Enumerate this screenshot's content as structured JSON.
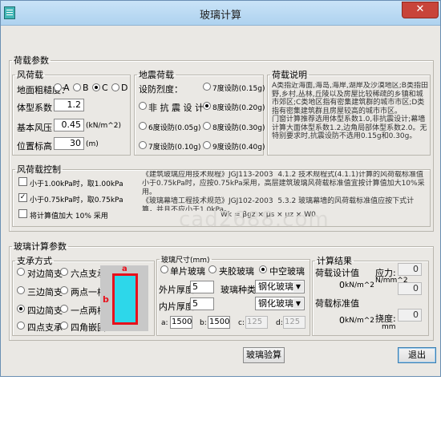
{
  "window": {
    "title": "玻璃计算",
    "close_glyph": "✕"
  },
  "load_group": {
    "legend": "荷载参数",
    "wind": {
      "legend": "风荷载",
      "roughness_label": "地面粗糙度：",
      "roughness_options": [
        "A",
        "B",
        "C",
        "D"
      ],
      "roughness_selected": "C",
      "shape_label": "体型系数：",
      "shape_value": "1.2",
      "base_pressure_label": "基本风压：",
      "base_pressure_value": "0.45",
      "base_pressure_unit": "(kN/m^2)",
      "height_label": "位置标高：",
      "height_value": "30",
      "height_unit": "(m)"
    },
    "seismic": {
      "legend": "地震荷载",
      "intensity_label": "设防烈度：",
      "options": [
        "非 抗 震 设 计",
        "6度设防(0.05g)",
        "7度设防(0.10g)",
        "7度设防(0.15g)",
        "8度设防(0.20g)",
        "8度设防(0.30g)",
        "9度设防(0.40g)"
      ],
      "selected": "8度设防(0.20g)"
    },
    "note": {
      "legend": "荷载说明",
      "text": "A类指近海面,海岛,海岸,湖岸及沙漠地区;B类指田野,乡村,丛林,丘陵以及房屋比较稀疏的乡镇和城市郊区;C类地区指有密集建筑群的城市市区;D类指有密集建筑群且房屋较高的城市市区。\n门窗计算推荐选用体型系数1.0,非抗震设计;幕墙计算大面体型系数1.2,边角局部体型系数2.0。无特别要求时,抗震设防不选用0.15g和0.30g。"
    },
    "wind_control": {
      "legend": "风荷载控制",
      "options": [
        {
          "label": "小于1.00kPa时，取1.00kPa",
          "checked": false
        },
        {
          "label": "小于0.75kPa时，取0.75kPa",
          "checked": true
        },
        {
          "label": "将计算值加大 10% 采用",
          "checked": false
        }
      ],
      "spec_text": "《建筑玻璃应用技术规程》JGJ113-2003  4.1.2 技术规程式(4.1.1)计算的风荷载标准值小于0.75kPa时，应按0.75kPa采用，高层建筑玻璃风荷载标准值宜按计算值加大10%采用。\n《玻璃幕墙工程技术规范》JGJ102-2003  5.3.2 玻璃幕墙的风荷载标准值应按下式计算，并且不应小于1.0kPa。",
      "formula": "Wk = βgz × μs × μz × W0"
    }
  },
  "glass_group": {
    "legend": "玻璃计算参数",
    "support": {
      "legend": "支承方式",
      "options": [
        "对边简支",
        "三边简支",
        "四边简支",
        "四点支承",
        "六点支承",
        "两点一槽",
        "一点两槽",
        "四角嵌固"
      ],
      "selected": "四边简支",
      "diagram_a": "a",
      "diagram_b": "b"
    },
    "size": {
      "legend": "玻璃尺寸(mm)",
      "type_options": [
        "单片玻璃",
        "夹胶玻璃",
        "中空玻璃"
      ],
      "type_selected": "中空玻璃",
      "outer_label": "外片厚度:",
      "outer_value": "5",
      "inner_label": "内片厚度:",
      "inner_value": "5",
      "kind_label": "玻璃种类:",
      "kind_outer": "钢化玻璃",
      "kind_inner": "钢化玻璃",
      "a_label": "a:",
      "a_value": "1500",
      "b_label": "b:",
      "b_value": "1500",
      "c_label": "c:",
      "c_value": "125",
      "d_label": "d:",
      "d_value": "125"
    },
    "result": {
      "legend": "计算结果",
      "design_label": "荷载设计值",
      "design_value": "0",
      "design_unit": "kN/m^2",
      "standard_label": "荷载标准值",
      "standard_value": "0",
      "standard_unit": "kN/m^2",
      "stress_label": "应力:",
      "stress_unit": "N/mm^2",
      "stress_value1": "0",
      "stress_value2": "0",
      "deflection_label": "挠度:",
      "deflection_unit": "mm",
      "deflection_value": "0"
    }
  },
  "actions": {
    "check_label": "玻璃验算",
    "exit_label": "退出"
  },
  "watermark": "cad2688.com"
}
